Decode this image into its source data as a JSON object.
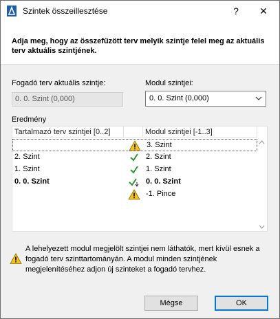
{
  "window": {
    "title": "Szintek összeillesztése",
    "help_glyph": "?",
    "close_glyph": "✕"
  },
  "heading": "Adja meg, hogy az összefűzött terv melyik szintje felel meg az aktuális terv aktuális szintjének.",
  "host_level": {
    "label": "Fogadó terv aktuális szintje:",
    "value": "0. 0. Szint (0,000)"
  },
  "module_level": {
    "label": "Modul szintjei:",
    "selected": "0. 0. Szint (0,000)"
  },
  "result": {
    "label": "Eredmény",
    "columns": [
      "Tartalmazó terv szintjei [0..2]",
      "",
      "Modul szintjei [-1..3]"
    ],
    "rows": [
      {
        "left": "",
        "status": "warning",
        "right": "3. Szint",
        "bold": false
      },
      {
        "left": "2. Szint",
        "status": "check",
        "right": "2. Szint",
        "bold": false
      },
      {
        "left": "1. Szint",
        "status": "check",
        "right": "1. Szint",
        "bold": false
      },
      {
        "left": "0. 0. Szint",
        "status": "check-anchor",
        "right": "0. 0. Szint",
        "bold": true
      },
      {
        "left": "",
        "status": "warning",
        "right": "-1. Pince",
        "bold": false
      }
    ]
  },
  "notice": "A lehelyezett modul megjelölt szintjei nem láthatók, mert kívül esnek a fogadó terv szinttartományán. A modul minden szintjének megjelenítéséhez adjon új szinteket a fogadó tervhez.",
  "buttons": {
    "cancel": "Mégse",
    "ok": "OK"
  },
  "colors": {
    "check": "#2e9a2e",
    "warning": "#f2c31b",
    "accent": "#0078d7"
  }
}
